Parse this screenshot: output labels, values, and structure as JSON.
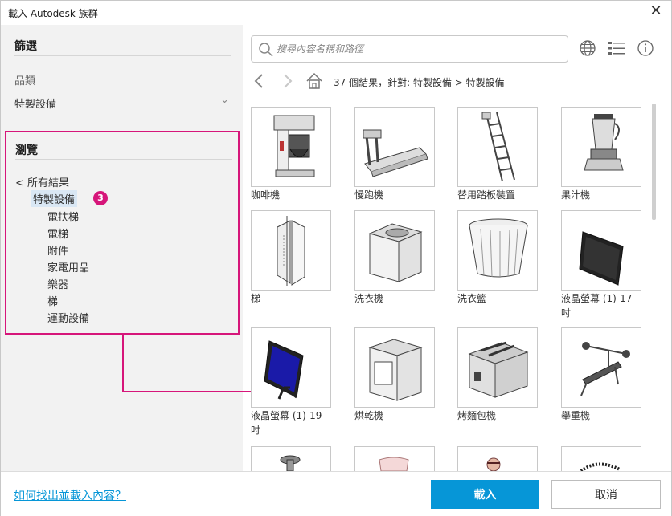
{
  "window": {
    "title": "載入 Autodesk 族群",
    "close_icon": "close-icon"
  },
  "sidebar": {
    "filter_heading": "篩選",
    "category_label": "品類",
    "category_value": "特製設備",
    "browse_heading": "瀏覽",
    "all_results": "< 所有結果",
    "selected": "特製設備",
    "badge": "3",
    "children": [
      "電扶梯",
      "電梯",
      "附件",
      "家電用品",
      "樂器",
      "梯",
      "運動設備"
    ]
  },
  "search": {
    "placeholder": "搜尋內容名稱和路徑"
  },
  "toolbar": {
    "globe_icon": "globe-icon",
    "list_icon": "list-view-icon",
    "info_icon": "info-icon"
  },
  "breadcrumb": {
    "text": "37 個結果，針對: 特製設備 > 特製設備"
  },
  "items": [
    {
      "label": "咖啡機",
      "icon": "coffee-machine-icon"
    },
    {
      "label": "慢跑機",
      "icon": "treadmill-icon"
    },
    {
      "label": "替用踏板裝置",
      "icon": "ladder-icon"
    },
    {
      "label": "果汁機",
      "icon": "blender-icon"
    },
    {
      "label": "梯",
      "icon": "ladder-panel-icon"
    },
    {
      "label": "洗衣機",
      "icon": "washing-machine-icon"
    },
    {
      "label": "洗衣籃",
      "icon": "laundry-basket-icon"
    },
    {
      "label": "液晶螢幕 (1)-17 吋",
      "icon": "lcd-monitor-icon"
    },
    {
      "label": "液晶螢幕 (1)-19 吋",
      "icon": "lcd-monitor-blue-icon"
    },
    {
      "label": "烘乾機",
      "icon": "dryer-icon"
    },
    {
      "label": "烤麵包機",
      "icon": "toaster-icon"
    },
    {
      "label": "舉重機",
      "icon": "weight-bench-icon"
    }
  ],
  "footer": {
    "help_link": "如何找出並載入內容？",
    "load_button": "載入",
    "cancel_button": "取消"
  },
  "colors": {
    "accent": "#0696d7",
    "highlight": "#d6167a",
    "selection": "#d9e7f4"
  }
}
